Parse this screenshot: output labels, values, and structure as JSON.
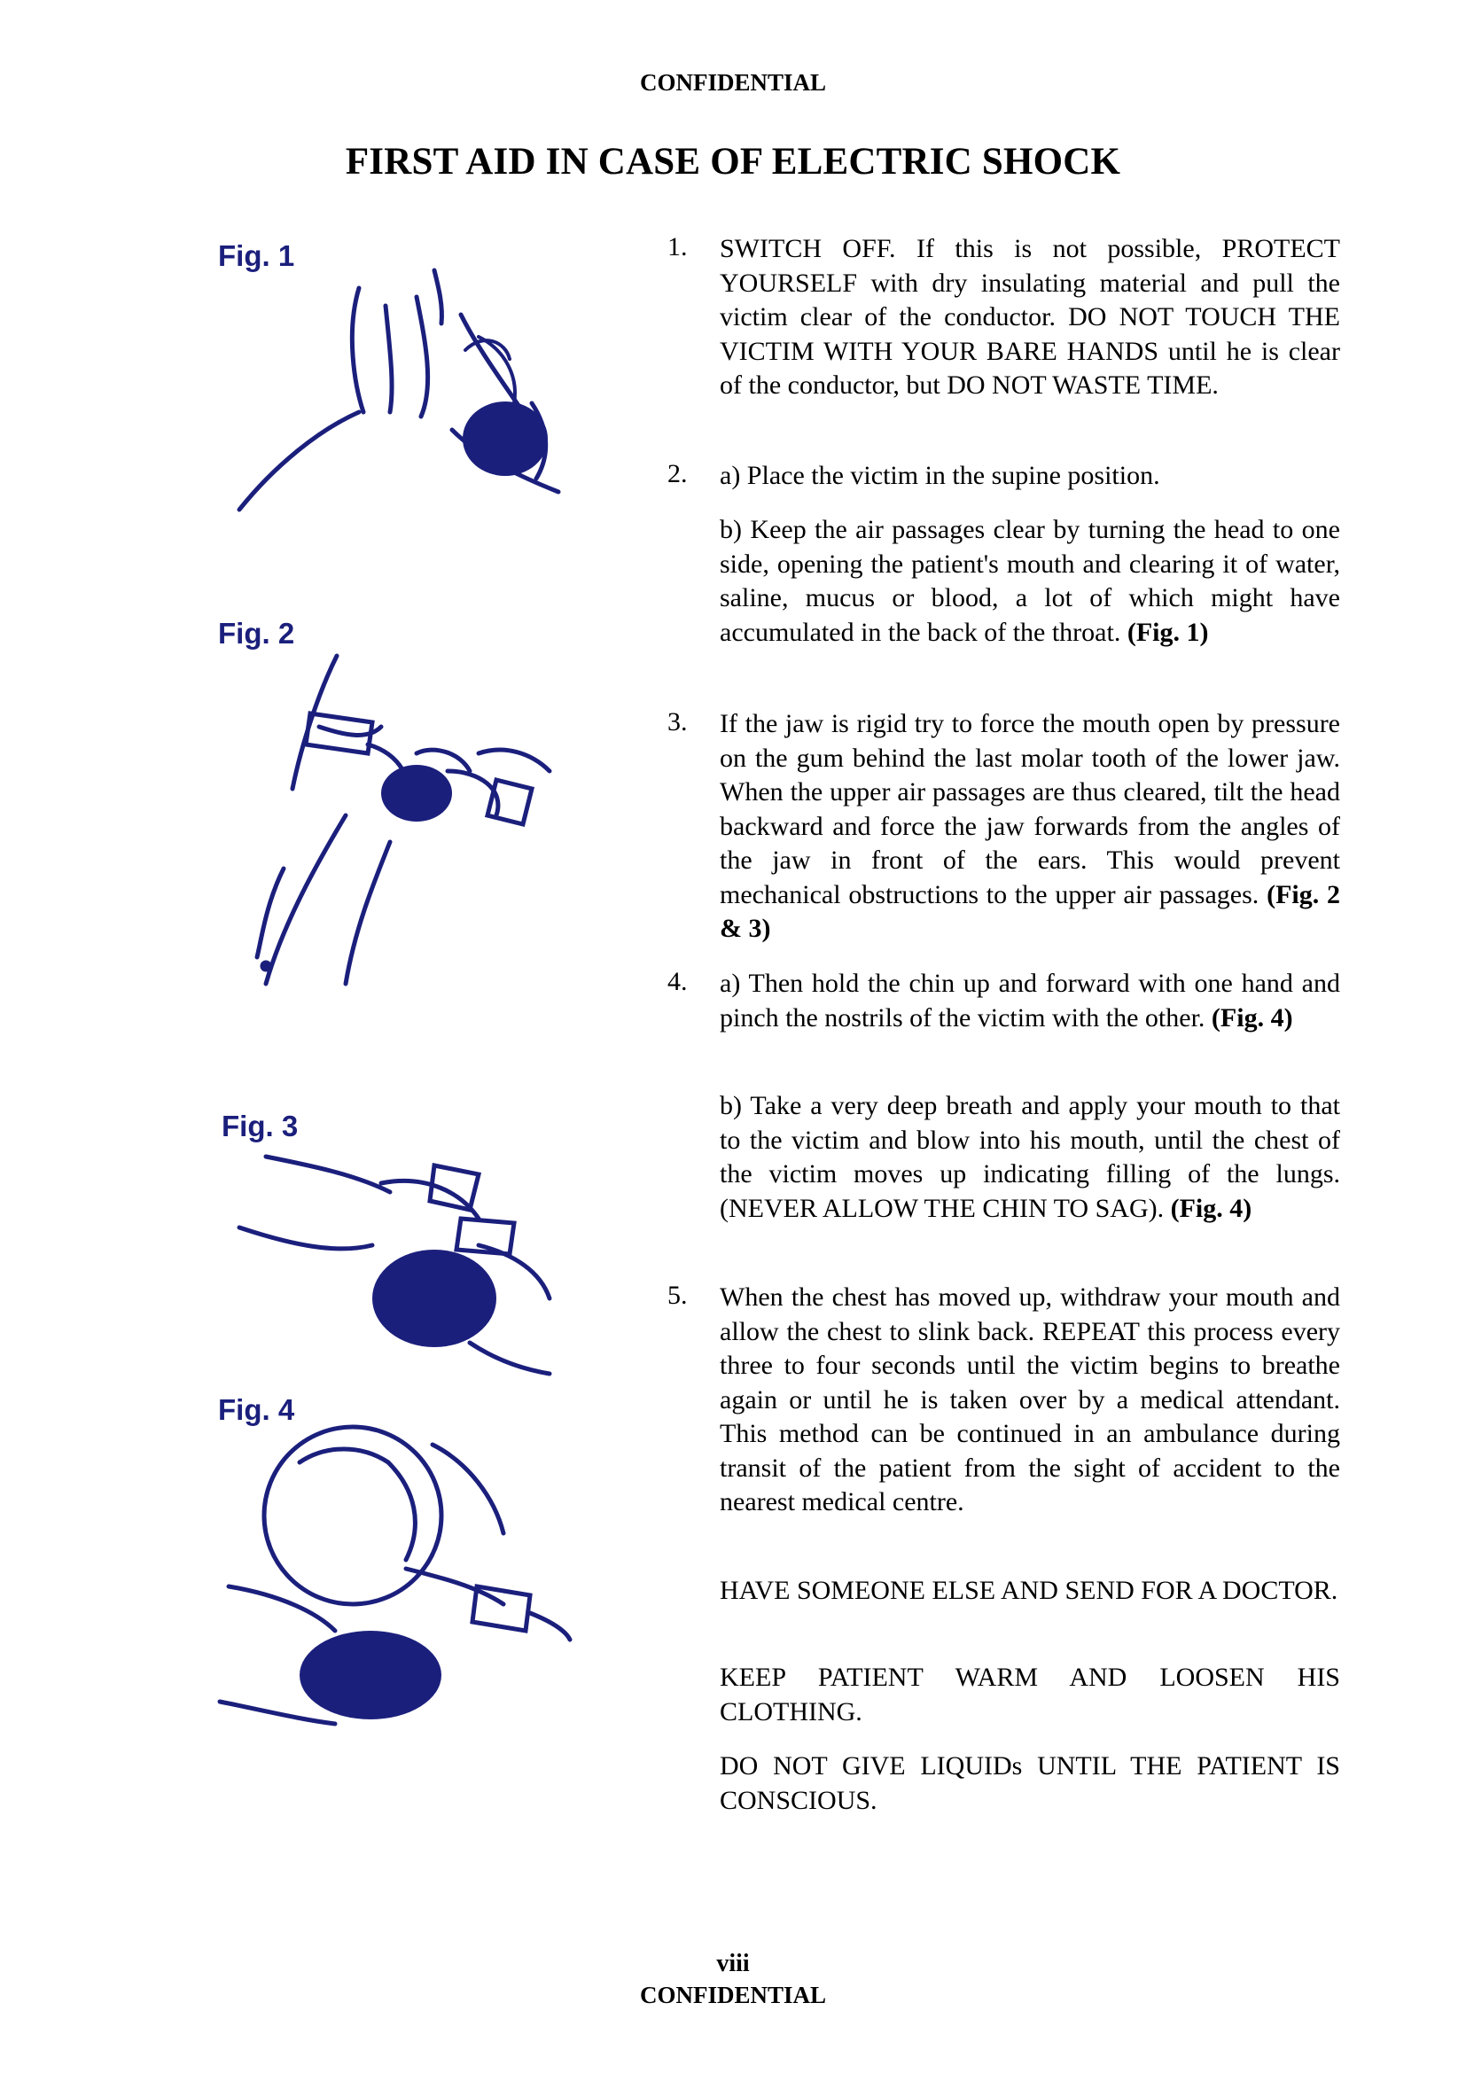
{
  "header": {
    "confidential": "CONFIDENTIAL"
  },
  "title": "FIRST AID IN CASE OF ELECTRIC SHOCK",
  "figures": [
    {
      "label": "Fig. 1"
    },
    {
      "label": "Fig. 2"
    },
    {
      "label": "Fig. 3"
    },
    {
      "label": "Fig. 4"
    }
  ],
  "steps": {
    "s1": {
      "num": "1.",
      "text": "SWITCH OFF. If this is not possible, PROTECT YOURSELF with dry insulating material and pull the victim clear of the conductor. DO NOT TOUCH THE VICTIM WITH YOUR BARE HANDS until he is clear of the conductor, but DO NOT WASTE TIME."
    },
    "s2": {
      "num": "2.",
      "a": "a) Place the victim in the supine position.",
      "b": "b) Keep the air passages clear by turning the head to one side, opening the patient's mouth and clearing it of water, saline, mucus or blood, a lot of which might have accumulated in the back of the throat.",
      "b_ref": "(Fig. 1)"
    },
    "s3": {
      "num": "3.",
      "text": "If the jaw is rigid try to force the mouth open by pressure on the gum behind the last molar tooth of the lower jaw. When the upper air passages are thus cleared, tilt the head backward and force the jaw forwards from the angles of the jaw in front of the ears. This would prevent mechanical obstructions to the upper air passages.",
      "ref": "(Fig. 2 & 3)"
    },
    "s4": {
      "num": "4.",
      "a": "a) Then hold the chin up and forward with one hand and pinch the nostrils of the victim with the other.",
      "a_ref": "(Fig. 4)",
      "b": "b) Take a very deep breath and apply your mouth to that to the victim and blow into his mouth, until the chest of the victim moves up indicating filling of the lungs. (NEVER ALLOW THE CHIN TO SAG).",
      "b_ref": "(Fig. 4)"
    },
    "s5": {
      "num": "5.",
      "text": "When the chest has moved up, withdraw your mouth and allow the chest to slink back. REPEAT this process every three to four seconds until the victim begins to breathe again or until he is taken over by a medical attendant. This method can be continued in an ambulance during transit of the patient from the sight of accident to the nearest medical centre."
    }
  },
  "notes": [
    "HAVE SOMEONE ELSE AND SEND FOR A DOCTOR.",
    "KEEP PATIENT WARM AND LOOSEN HIS CLOTHING.",
    "DO NOT GIVE LIQUIDs UNTIL THE PATIENT IS CONSCIOUS."
  ],
  "footer": {
    "page": "viii",
    "confidential": "CONFIDENTIAL"
  },
  "colors": {
    "figure_ink": "#1b1f7c",
    "text": "#000000"
  }
}
